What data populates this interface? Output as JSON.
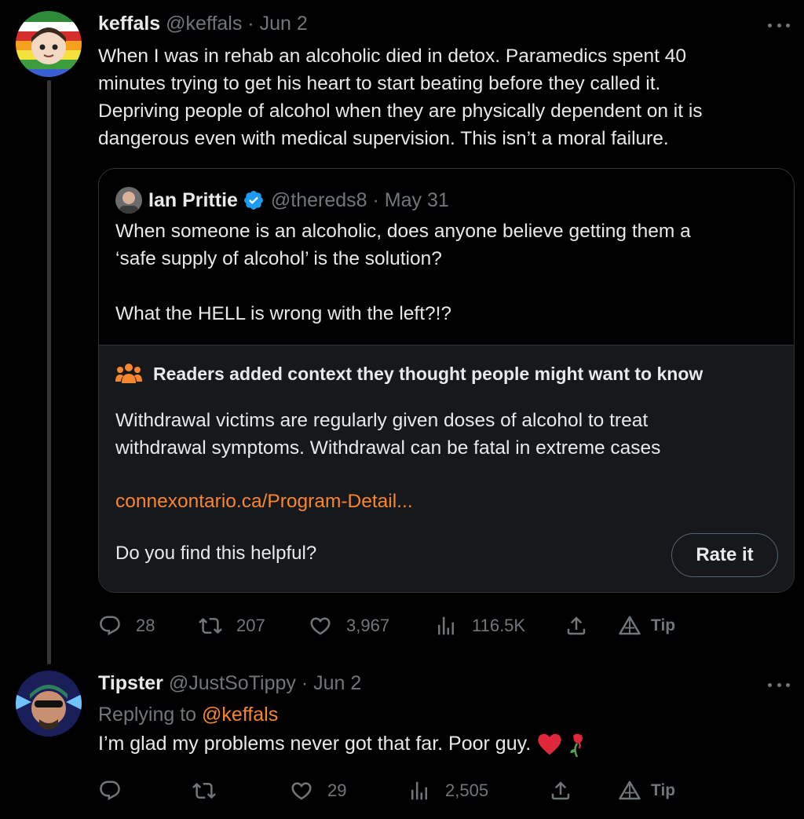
{
  "tweet1": {
    "display_name": "keffals",
    "handle_meta": "@keffals · Jun 2",
    "lines": [
      "When I was in rehab an alcoholic died in detox. Paramedics spent 40",
      "minutes trying to get his heart to start beating before they called it.",
      "Depriving people of alcohol when they are physically dependent on it is",
      "dangerous even with medical supervision. This isn’t a moral failure."
    ],
    "quote": {
      "display_name": "Ian Prittie",
      "handle_meta": "@thereds8 · May 31",
      "lines": [
        "When someone is an alcoholic, does anyone believe getting them a",
        "‘safe supply of alcohol’ is the solution?",
        "",
        "What the HELL is wrong with the left?!?"
      ],
      "community_note": {
        "title": "Readers added context they thought people might want to know",
        "lines": [
          "Withdrawal victims are regularly given doses of alcohol to treat",
          "withdrawal symptoms. Withdrawal can be fatal in extreme cases"
        ],
        "link": "connexontario.ca/Program-Detail...",
        "helpful_prompt": "Do you find this helpful?",
        "rate_button": "Rate it"
      }
    },
    "actions": {
      "replies": "28",
      "reposts": "207",
      "likes": "3,967",
      "views": "116.5K",
      "tip": "Tip"
    }
  },
  "tweet2": {
    "display_name": "Tipster",
    "handle_meta": "@JustSoTippy · Jun 2",
    "replying_prefix": "Replying to",
    "replying_handle": "@keffals",
    "text": "I’m glad my problems never got that far. Poor guy.",
    "actions": {
      "replies": "",
      "reposts": "",
      "likes": "29",
      "views": "2,505",
      "tip": "Tip"
    }
  },
  "colors": {
    "background": "#000000",
    "text": "#e7e9ea",
    "muted": "#71767b",
    "link_orange": "#f7862f",
    "verified_blue": "#1d9bf0",
    "note_bg": "#16181c"
  }
}
